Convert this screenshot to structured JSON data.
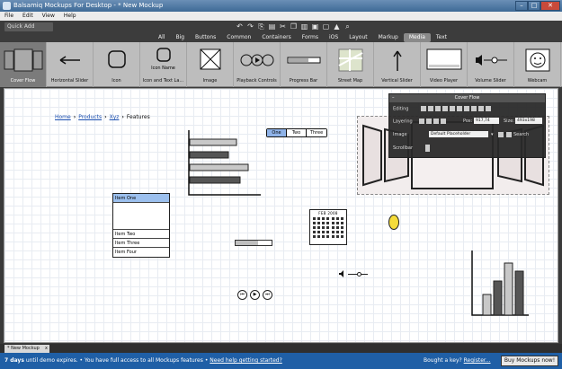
{
  "window": {
    "title": "Balsamiq Mockups For Desktop - * New Mockup",
    "minimize": "–",
    "maximize": "□",
    "close": "✕"
  },
  "menu": [
    "File",
    "Edit",
    "View",
    "Help"
  ],
  "toolbar": {
    "quick_add_placeholder": "Quick Add",
    "icons": [
      "undo-icon",
      "redo-icon",
      "copy-icon",
      "paste-icon",
      "cut-icon",
      "duplicate-icon",
      "delete-icon",
      "group-icon",
      "ungroup-icon",
      "lock-icon",
      "search-icon"
    ]
  },
  "categories": {
    "items": [
      "All",
      "Big",
      "Buttons",
      "Common",
      "Containers",
      "Forms",
      "iOS",
      "Layout",
      "Markup",
      "Media",
      "Text"
    ],
    "active": "Media"
  },
  "library": [
    {
      "label": "Cover Flow",
      "selected": true
    },
    {
      "label": "Horizontal Slider"
    },
    {
      "label": "Icon"
    },
    {
      "label": "Icon and Text La..."
    },
    {
      "label": "Image"
    },
    {
      "label": "Playback Controls"
    },
    {
      "label": "Progress Bar"
    },
    {
      "label": "Street Map"
    },
    {
      "label": "Vertical Slider"
    },
    {
      "label": "Video Player"
    },
    {
      "label": "Volume Slider"
    },
    {
      "label": "Webcam"
    }
  ],
  "library_icon_text": "Icon Name",
  "canvas": {
    "breadcrumb": {
      "items": [
        "Home",
        "Products",
        "Xyz"
      ],
      "current": "Features",
      "sep": "›"
    },
    "button_bar": [
      "One",
      "Two",
      "Three"
    ],
    "list": [
      "Item One",
      "",
      "Item Two",
      "Item Three",
      "Item Four"
    ],
    "calendar_title": "FEB 2008",
    "progress_value": 0.62,
    "playback": [
      "⏮",
      "▶",
      "⏭"
    ],
    "volume_icon": "speaker-icon",
    "hbar_values": [
      0.72,
      0.6,
      0.9,
      0.78
    ],
    "vbar_values": [
      0.35,
      0.57,
      0.88,
      0.74
    ]
  },
  "inspector": {
    "title": "Cover Flow",
    "editing_label": "Editing",
    "layering_label": "Layering",
    "pos_label": "Pos:",
    "pos_value": "917,74",
    "size_label": "Size:",
    "size_value": "493x198",
    "image_label": "Image",
    "image_value": "Default Placeholder",
    "search_label": "Search",
    "scrollbar_label": "Scrollbar"
  },
  "tabs": {
    "doc_tab": "* New Mockup",
    "close": "x"
  },
  "trial": {
    "days": "7 days",
    "expire_text": " until demo expires.",
    "sep": "•",
    "access_text": "You have full access to all Mockups features",
    "help_link": "Need help getting started?",
    "key_question": "Bought a key?",
    "register_link": "Register...",
    "buy_button": "Buy Mockups now!"
  }
}
